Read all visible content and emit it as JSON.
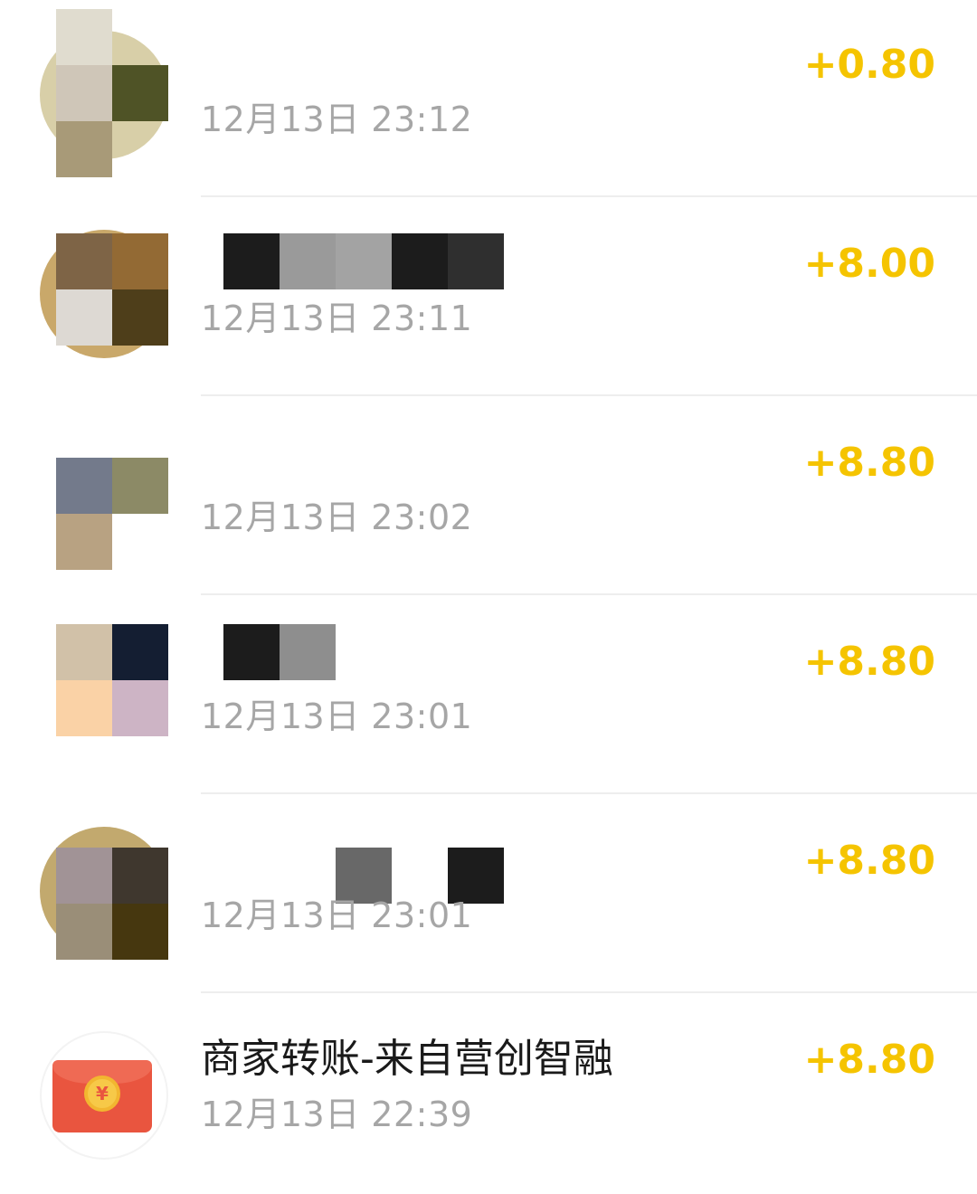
{
  "transactions": [
    {
      "title": "",
      "time": "12月13日 23:12",
      "amount": "+0.80"
    },
    {
      "title": "",
      "time": "12月13日 23:11",
      "amount": "+8.00"
    },
    {
      "title": "",
      "time": "12月13日 23:02",
      "amount": "+8.80"
    },
    {
      "title": "",
      "time": "12月13日 23:01",
      "amount": "+8.80"
    },
    {
      "title": "",
      "time": "12月13日 23:01",
      "amount": "+8.80"
    },
    {
      "title": "商家转账-来自营创智融",
      "time": "12月13日 22:39",
      "amount": "+8.80"
    }
  ],
  "icons": {
    "red_packet": "red-packet-icon",
    "yuan_symbol": "¥"
  },
  "colors": {
    "amount": "#f5c400",
    "time": "#a6a6a6",
    "title": "#1a1a1a",
    "divider": "#eeeeee",
    "red_packet": "#e9553f"
  }
}
